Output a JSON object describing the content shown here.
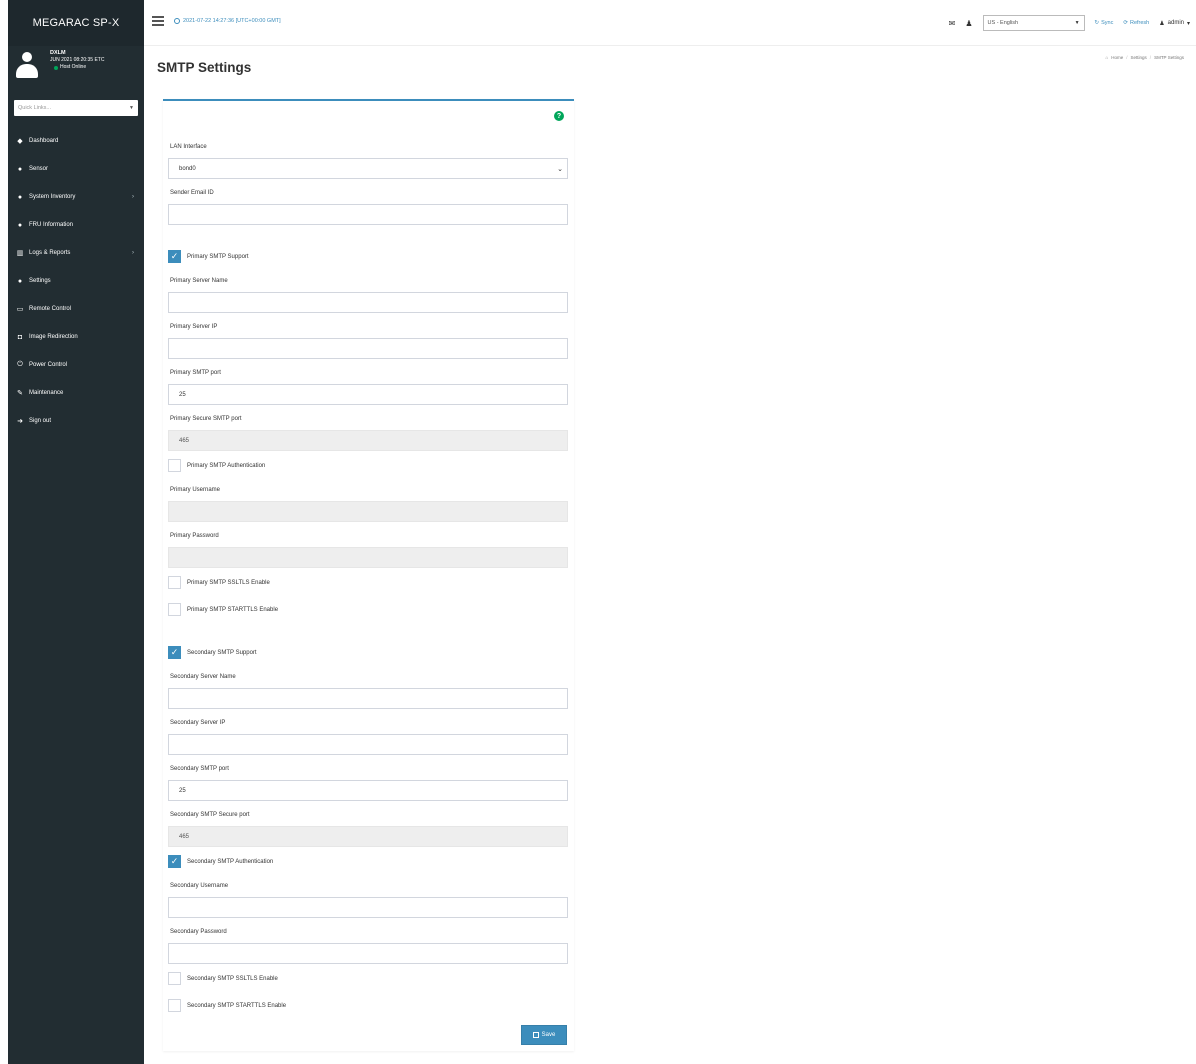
{
  "sidebar": {
    "brand": "MEGARAC SP-X",
    "user_name": "DXLM",
    "user_time": "JUN 2021 08:20:35 ETC",
    "host_status": "Host Online",
    "quick_links_placeholder": "Quick Links...",
    "items": [
      {
        "label": "Dashboard",
        "icon": "tachometer-icon"
      },
      {
        "label": "Sensor",
        "icon": "dashboard-icon"
      },
      {
        "label": "System Inventory",
        "icon": "cube-icon"
      },
      {
        "label": "FRU Information",
        "icon": "info-circle-icon"
      },
      {
        "label": "Logs & Reports",
        "icon": "bar-chart-icon"
      },
      {
        "label": "Settings",
        "icon": "cog-icon"
      },
      {
        "label": "Remote Control",
        "icon": "desktop-icon"
      },
      {
        "label": "Image Redirection",
        "icon": "disk-icon"
      },
      {
        "label": "Power Control",
        "icon": "power-icon"
      },
      {
        "label": "Maintenance",
        "icon": "wrench-icon"
      },
      {
        "label": "Sign out",
        "icon": "sign-out-icon"
      }
    ]
  },
  "topbar": {
    "datetime": "2021-07-22 14:27:36 [UTC+00:00 GMT]",
    "language": "US - English",
    "sync_label": "Sync",
    "refresh_label": "Refresh",
    "user_label": "admin"
  },
  "page": {
    "title": "SMTP Settings",
    "breadcrumb": [
      "Home",
      "Settings",
      "SMTP Settings"
    ]
  },
  "form": {
    "lan_interface_label": "LAN Interface",
    "lan_interface_value": "bond0",
    "sender_email_label": "Sender Email ID",
    "sender_email_value": "",
    "primary_support_label": "Primary SMTP Support",
    "primary_support_checked": true,
    "primary_server_name_label": "Primary Server Name",
    "primary_server_ip_label": "Primary Server IP",
    "primary_port_label": "Primary SMTP port",
    "primary_port_value": "25",
    "primary_secure_port_label": "Primary Secure SMTP port",
    "primary_secure_port_value": "465",
    "primary_auth_label": "Primary SMTP Authentication",
    "primary_auth_checked": false,
    "primary_username_label": "Primary Username",
    "primary_password_label": "Primary Password",
    "primary_ssltls_label": "Primary SMTP SSLTLS Enable",
    "primary_starttls_label": "Primary SMTP STARTTLS Enable",
    "secondary_support_label": "Secondary SMTP Support",
    "secondary_support_checked": true,
    "secondary_server_name_label": "Secondary Server Name",
    "secondary_server_ip_label": "Secondary Server IP",
    "secondary_port_label": "Secondary SMTP port",
    "secondary_port_value": "25",
    "secondary_secure_port_label": "Secondary SMTP Secure port",
    "secondary_secure_port_value": "465",
    "secondary_auth_label": "Secondary SMTP Authentication",
    "secondary_auth_checked": true,
    "secondary_username_label": "Secondary Username",
    "secondary_password_label": "Secondary Password",
    "secondary_ssltls_label": "Secondary SMTP SSLTLS Enable",
    "secondary_starttls_label": "Secondary SMTP STARTTLS Enable",
    "save_label": "Save"
  },
  "colors": {
    "sidebar_bg": "#222d32",
    "accent": "#3c8dbc",
    "help_icon": "#00a65a"
  }
}
